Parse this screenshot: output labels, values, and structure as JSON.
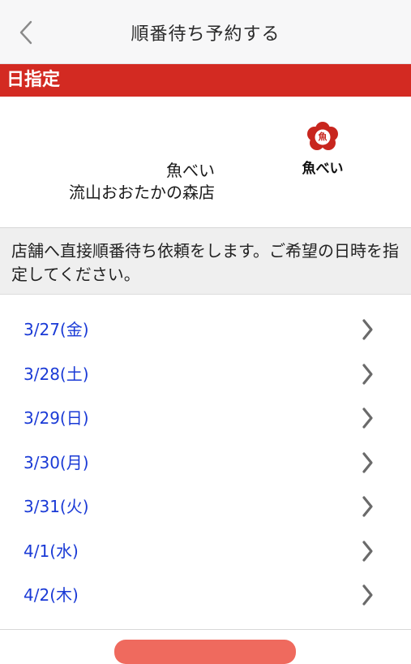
{
  "header": {
    "title": "順番待ち予約する",
    "back_icon": "chevron-left-icon"
  },
  "section": {
    "title": "日指定"
  },
  "store": {
    "name_line1": "魚べい",
    "name_line2": "流山おおたかの森店",
    "logo_text": "魚べい",
    "logo_mark_text": "魚"
  },
  "notice": {
    "text": "店舗へ直接順番待ち依頼をします。ご希望の日時を指定してください。"
  },
  "dates": [
    {
      "label": "3/27(金)"
    },
    {
      "label": "3/28(土)"
    },
    {
      "label": "3/29(日)"
    },
    {
      "label": "3/30(月)"
    },
    {
      "label": "3/31(火)"
    },
    {
      "label": "4/1(水)"
    },
    {
      "label": "4/2(木)"
    }
  ],
  "colors": {
    "accent_red": "#d32a22",
    "date_blue": "#1a3ad6",
    "button_red": "#ef6a5e"
  }
}
